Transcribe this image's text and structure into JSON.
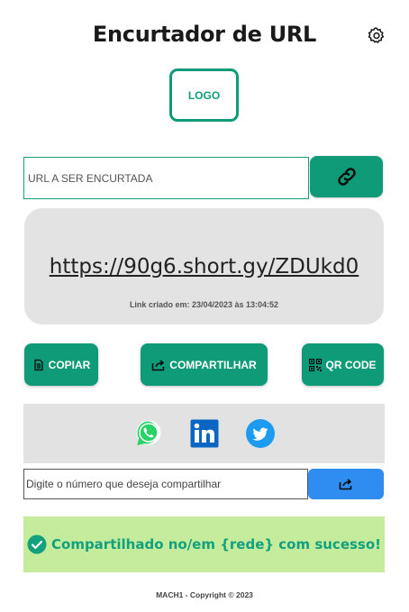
{
  "header": {
    "title": "Encurtador de URL",
    "settings_icon": "gear-icon"
  },
  "logo": {
    "label": "LOGO",
    "color": "#0f9b78"
  },
  "shortener": {
    "url_placeholder": "URL A SER ENCURTADA",
    "url_value": "",
    "shorten_icon": "link-icon"
  },
  "result": {
    "short_url": "https://90g6.short.gy/ZDUkd0",
    "created_label": "Link criado em: 23/04/2023 às 13:04:52"
  },
  "actions": {
    "copy_label": "COPIAR",
    "share_label": "COMPARTILHAR",
    "qr_label": "QR CODE"
  },
  "social": {
    "networks": [
      "whatsapp-icon",
      "linkedin-icon",
      "twitter-icon"
    ]
  },
  "share_phone": {
    "placeholder": "Digite o número que deseja compartilhar",
    "value": "",
    "send_icon": "share-icon"
  },
  "status": {
    "message": "Compartilhado no/em {rede} com sucesso!"
  },
  "footer": {
    "copyright": "MACH1 - Copyright © 2023"
  },
  "colors": {
    "primary": "#0f9b78",
    "accent_blue": "#2f8df1",
    "success_bg": "#c5ec9d",
    "card_bg": "#e3e3e3"
  }
}
